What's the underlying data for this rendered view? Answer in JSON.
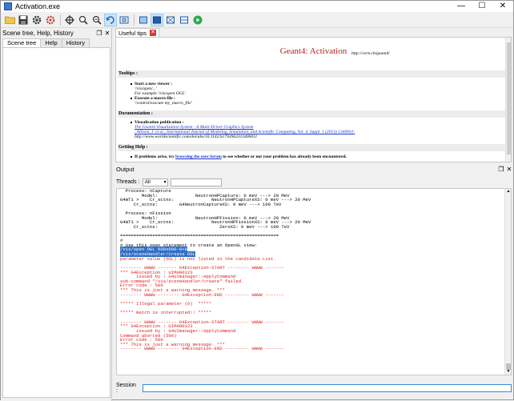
{
  "window": {
    "title": "Activation.exe",
    "controls": [
      "—",
      "☐",
      "✕"
    ]
  },
  "toolbar": {
    "icons": [
      "open-folder-icon",
      "save-icon",
      "gear-icon",
      "settings-icon",
      "crosshair-icon",
      "zoom-in-icon",
      "zoom-out-icon",
      "rotate-icon",
      "perspective-icon",
      "ortho-icon",
      "surface-icon",
      "wireframe-icon",
      "hidden-line-icon",
      "run-icon"
    ]
  },
  "left_dock": {
    "title": "Scene tree, Help, History",
    "tabs": [
      "Scene tree",
      "Help",
      "History"
    ]
  },
  "tips": {
    "tab_label": "Useful tips",
    "heading": "Geant4: Activation",
    "url": "http://cern.ch/geant4/",
    "tooltips_header": "Tooltips :",
    "start_viewer": "Start a new viewer :",
    "vis_open": "'/vis/open/...'",
    "example_ogl": "For example '/vis/open OGL'",
    "exec_macro": "Execute a macro file :",
    "control_exec": "'/control/execute my_macro_file'",
    "documentation_header": "Documentation :",
    "vis_pub": "Visualisation publication :",
    "pub_line1": "The Geant4 Visualization System - A Multi-Driver Graphics System",
    "pub_line2": ", Allison, J. et al., International Journal of Modeling, Simulation, and Scientific Computing, Vol. 4, Suppl. 1 (2013) 1340001:",
    "pub_line3": "http://www.worldscientific.com/doi/abs/10.1142/S1793962313400011",
    "getting_help_header": "Getting Help :",
    "help_pre": "If problems arise, try ",
    "help_link": "browsing the user forum",
    "help_post": " to see whether or not your problem has already been encountered."
  },
  "output": {
    "title": "Output",
    "threads_label": "Threads :",
    "threads_value": "All",
    "lines": [
      {
        "t": "  Process: nCapture",
        "c": "blk"
      },
      {
        "t": "        Model:              NeutronHPCapture: 0 meV ---> 20 MeV",
        "c": "blk"
      },
      {
        "t": "G4WT1 >    Cr_sctns:              NeutronHPCaptureXS: 0 meV ---> 20 MeV",
        "c": "blk"
      },
      {
        "t": "     Cr_sctns:        G4NeutronCaptureXS: 0 meV ---> 100 TeV",
        "c": "blk"
      },
      {
        "t": "",
        "c": "blk"
      },
      {
        "t": "  Process: nFission",
        "c": "blk"
      },
      {
        "t": "        Model:              NeutronHPFission: 0 meV ---> 20 MeV",
        "c": "blk"
      },
      {
        "t": "G4WT1 >    Cr_sctns:              NeutronHPFissionXS: 0 meV ---> 20 MeV",
        "c": "blk"
      },
      {
        "t": "     Cr_sctns:                       ZeroXS: 0 meV ---> 100 TeV",
        "c": "blk"
      },
      {
        "t": "",
        "c": "blk"
      },
      {
        "t": "===========================================================",
        "c": "blk"
      },
      {
        "t": "#",
        "c": "blk"
      },
      {
        "t": "# Use this open statement to create an OpenGL view:",
        "c": "blk"
      },
      {
        "t": "/vis/open OGL 600x600-0+0",
        "c": "hl"
      },
      {
        "t": "/vis/sceneHandler/create OGL",
        "c": "hl"
      },
      {
        "t": "parameter value (OGL) is not listed in the candidate List.",
        "c": "red"
      },
      {
        "t": "",
        "c": "blk"
      },
      {
        "t": "-------- WWWW ------- G4Exception-START -------- WWWW -------",
        "c": "red"
      },
      {
        "t": "*** G4Exception : UIMAN0123",
        "c": "red"
      },
      {
        "t": "      issued by : G4UImanager::ApplyCommand",
        "c": "red"
      },
      {
        "t": "sub-command \"/vis/sceneHandler/create\" failed.",
        "c": "red"
      },
      {
        "t": "Error code : 500",
        "c": "red"
      },
      {
        "t": "*** This is just a warning message. ***",
        "c": "red"
      },
      {
        "t": "-------- WWWW -------- G4Exception-END --------- WWWW -------",
        "c": "red"
      },
      {
        "t": "",
        "c": "blk"
      },
      {
        "t": "***** Illegal parameter (0)  *****",
        "c": "red"
      },
      {
        "t": "",
        "c": "blk"
      },
      {
        "t": "***** Batch is interrupted!! *****",
        "c": "red"
      },
      {
        "t": "",
        "c": "blk"
      },
      {
        "t": "-------- WWWW ------- G4Exception-START -------- WWWW -------",
        "c": "red"
      },
      {
        "t": "*** G4Exception : UIMAN0123",
        "c": "red"
      },
      {
        "t": "      issued by : G4UImanager::ApplyCommand",
        "c": "red"
      },
      {
        "t": "Command aborted (500)",
        "c": "red"
      },
      {
        "t": "Error code : 500",
        "c": "red"
      },
      {
        "t": "*** This is just a warning message. ***",
        "c": "red"
      },
      {
        "t": "-------- WWWW -------- G4Exception-END --------- WWWW -------",
        "c": "red"
      }
    ]
  },
  "session": {
    "label": "Session :",
    "value": ""
  }
}
